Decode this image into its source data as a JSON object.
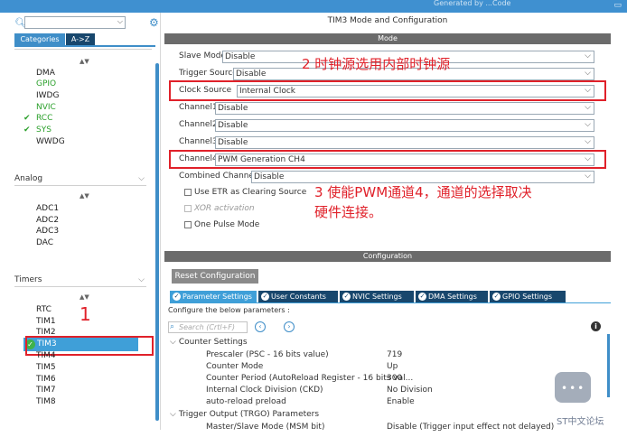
{
  "topbar": {
    "fragment_a": "Generated by ...",
    "fragment_b": "Code"
  },
  "left": {
    "tabs": {
      "categories": "Categories",
      "az": "A->Z"
    },
    "system_items": [
      {
        "label": "DMA",
        "enabled": false
      },
      {
        "label": "GPIO",
        "enabled": false,
        "color": "#2ba02b"
      },
      {
        "label": "IWDG",
        "enabled": false
      },
      {
        "label": "NVIC",
        "enabled": false,
        "color": "#2ba02b"
      },
      {
        "label": "RCC",
        "enabled": true
      },
      {
        "label": "SYS",
        "enabled": true
      },
      {
        "label": "WWDG",
        "enabled": false
      }
    ],
    "analog_header": "Analog",
    "analog_items": [
      "ADC1",
      "ADC2",
      "ADC3",
      "DAC"
    ],
    "timers_header": "Timers",
    "timer_items": [
      "RTC",
      "TIM1",
      "TIM2",
      "TIM3",
      "TIM4",
      "TIM5",
      "TIM6",
      "TIM7",
      "TIM8"
    ],
    "selected_item": "TIM3",
    "annotation_1": "1"
  },
  "right": {
    "title": "TIM3 Mode and Configuration",
    "mode_bar": "Mode",
    "fields": [
      {
        "label": "Slave Mode",
        "value": "Disable"
      },
      {
        "label": "Trigger Source",
        "value": "Disable"
      },
      {
        "label": "Clock Source",
        "value": "Internal Clock"
      },
      {
        "label": "Channel1",
        "value": "Disable"
      },
      {
        "label": "Channel2",
        "value": "Disable"
      },
      {
        "label": "Channel3",
        "value": "Disable"
      },
      {
        "label": "Channel4",
        "value": "PWM Generation CH4"
      },
      {
        "label": "Combined Channels",
        "value": "Disable"
      }
    ],
    "checkboxes": [
      {
        "label": "Use ETR as Clearing Source",
        "checked": false,
        "disabled": false
      },
      {
        "label": "XOR activation",
        "checked": false,
        "disabled": true
      },
      {
        "label": "One Pulse Mode",
        "checked": false,
        "disabled": false
      }
    ],
    "annotation_2": "2 时钟源选用内部时钟源",
    "annotation_3_line1": "3 使能PWM通道4，通道的选择取决",
    "annotation_3_line2": "硬件连接。",
    "config_bar": "Configuration",
    "reset_button": "Reset Configuration",
    "param_tabs": [
      "Parameter Settings",
      "User Constants",
      "NVIC Settings",
      "DMA Settings",
      "GPIO Settings"
    ],
    "configure_text": "Configure the below parameters :",
    "search_placeholder": "Search (Crtl+F)",
    "tree": {
      "counter_settings": "Counter Settings",
      "params": [
        {
          "name": "Prescaler (PSC - 16 bits value)",
          "value": "719"
        },
        {
          "name": "Counter Mode",
          "value": "Up"
        },
        {
          "name": "Counter Period (AutoReload Register - 16 bits val...",
          "value": "300"
        },
        {
          "name": "Internal Clock Division (CKD)",
          "value": "No Division"
        },
        {
          "name": "auto-reload preload",
          "value": "Enable"
        }
      ],
      "trigger_output": "Trigger Output (TRGO) Parameters",
      "trgo_param": {
        "name": "Master/Slave Mode (MSM bit)",
        "value": "Disable (Trigger input effect not delayed)"
      }
    }
  },
  "watermark": {
    "text": "ST中文论坛"
  },
  "colors": {
    "accent": "#3f8ec8",
    "annotation_red": "#e0212a",
    "enabled_green": "#2ba02b",
    "dark_tab": "#18476d"
  }
}
